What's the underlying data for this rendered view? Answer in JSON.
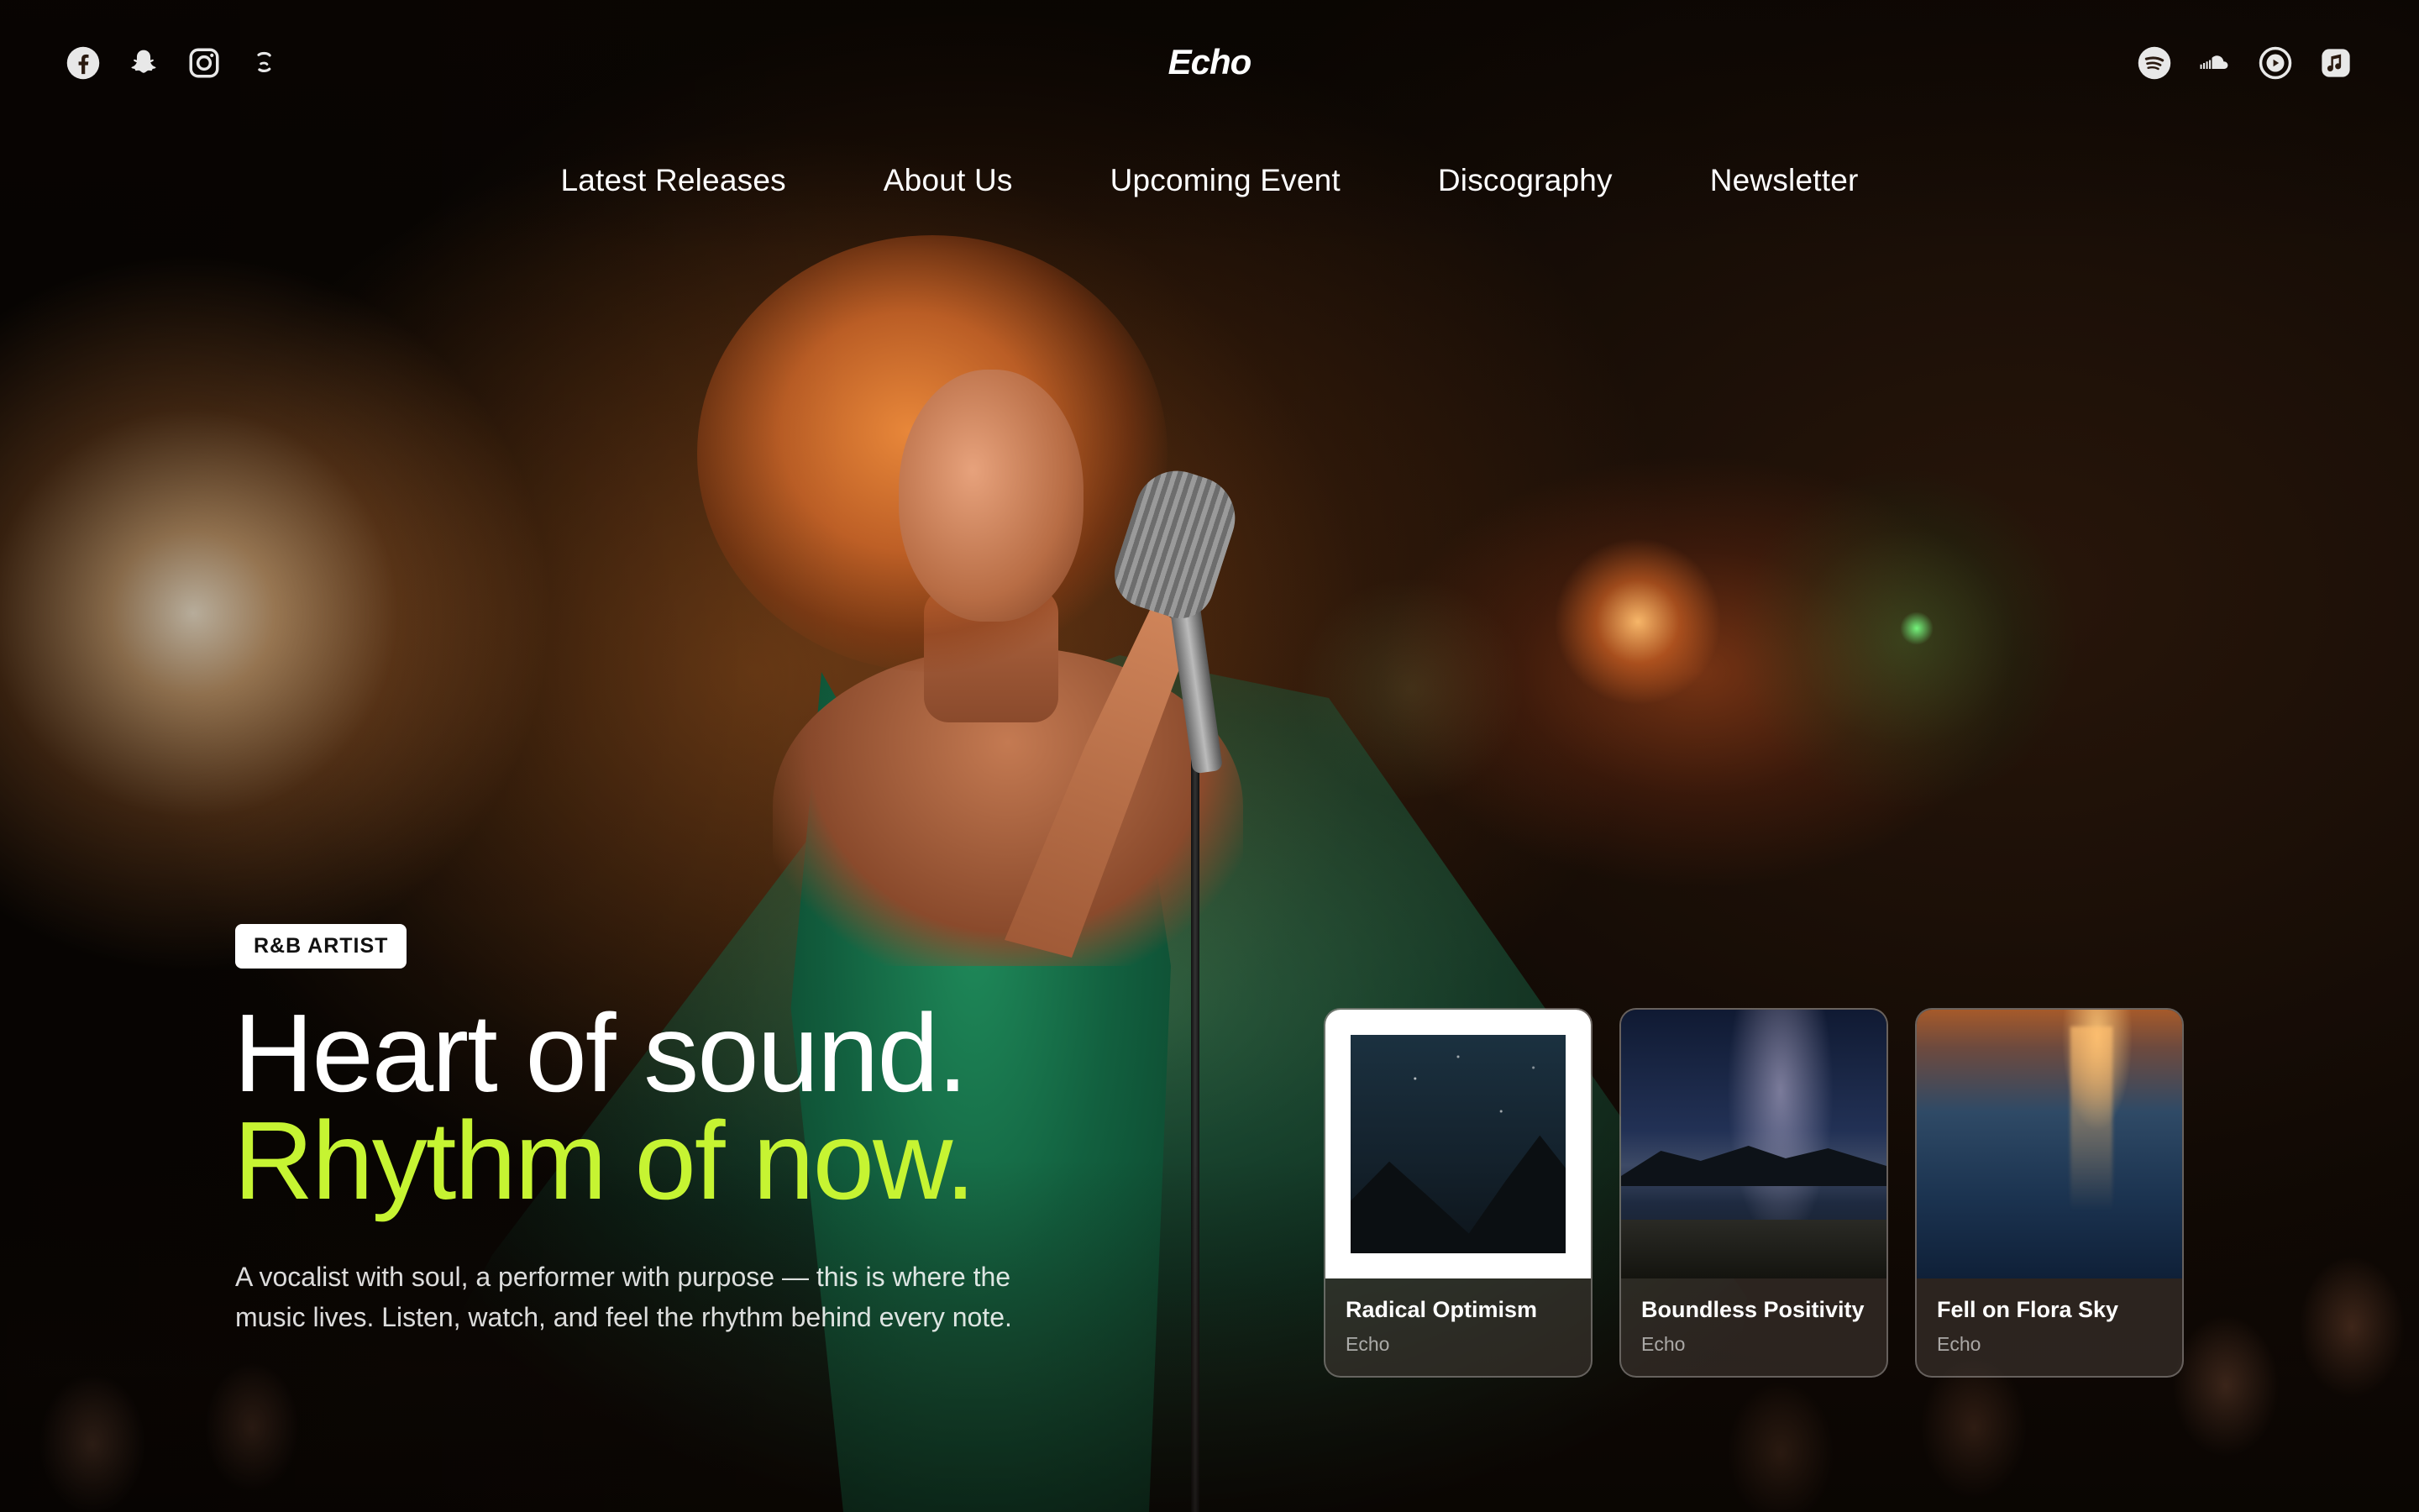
{
  "brand": {
    "name": "Echo"
  },
  "social_left": [
    {
      "icon": "facebook-icon"
    },
    {
      "icon": "snapchat-icon"
    },
    {
      "icon": "instagram-icon"
    },
    {
      "icon": "threads-icon"
    }
  ],
  "social_right": [
    {
      "icon": "spotify-icon"
    },
    {
      "icon": "soundcloud-icon"
    },
    {
      "icon": "youtube-music-icon"
    },
    {
      "icon": "apple-music-icon"
    }
  ],
  "nav": {
    "items": [
      "Latest Releases",
      "About Us",
      "Upcoming Event",
      "Discography",
      "Newsletter"
    ]
  },
  "hero": {
    "badge": "R&B ARTIST",
    "headline_line1": "Heart of sound.",
    "headline_line2": "Rhythm of now.",
    "description": "A vocalist with soul, a performer with purpose — this is where the music lives. Listen, watch, and feel the rhythm behind every note."
  },
  "albums": [
    {
      "title": "Radical Optimism",
      "artist": "Echo"
    },
    {
      "title": "Boundless Positivity",
      "artist": "Echo"
    },
    {
      "title": "Fell on Flora Sky",
      "artist": "Echo"
    }
  ],
  "colors": {
    "accent": "#c6f432",
    "text": "#ffffff",
    "badge_bg": "#ffffff"
  }
}
